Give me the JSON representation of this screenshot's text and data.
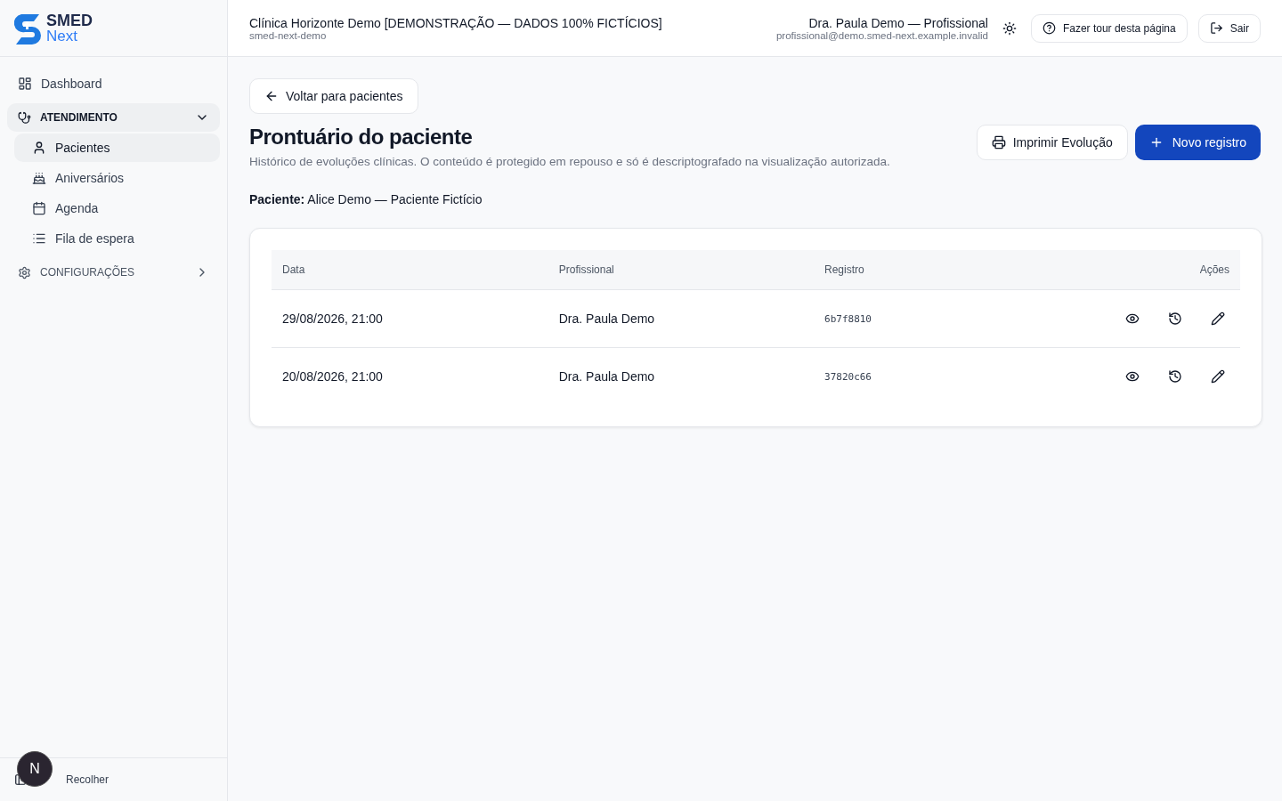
{
  "brand": {
    "name": "SMED",
    "sub": "Next"
  },
  "sidebar": {
    "items": [
      {
        "kind": "link",
        "label": "Dashboard",
        "selected": false
      },
      {
        "kind": "section",
        "label": "ATENDIMENTO",
        "expanded": true,
        "children": [
          {
            "label": "Pacientes",
            "selected": true
          },
          {
            "label": "Aniversários",
            "selected": false
          },
          {
            "label": "Agenda",
            "selected": false
          },
          {
            "label": "Fila de espera",
            "selected": false
          }
        ]
      },
      {
        "kind": "section",
        "label": "CONFIGURAÇÕES",
        "expanded": false
      }
    ],
    "collapse": "Recolher",
    "avatar": "N"
  },
  "header": {
    "clinic": "Clínica Horizonte Demo [DEMONSTRAÇÃO — DADOS 100% FICTÍCIOS]",
    "slug": "smed-next-demo",
    "user": "Dra. Paula Demo — Profissional",
    "email": "profissional@demo.smed-next.example.invalid",
    "tour": "Fazer tour desta página",
    "logout": "Sair"
  },
  "back": "Voltar para pacientes",
  "title": "Prontuário do paciente",
  "description": "Histórico de evoluções clínicas. O conteúdo é protegido em repouso e só é descriptografado na visualização autorizada.",
  "print": "Imprimir Evolução",
  "new": "Novo registro",
  "patient": "**Paciente:** Alice Demo — Paciente Fictício",
  "table": {
    "columns": [
      "Data",
      "Profissional",
      "Registro",
      "Ações"
    ],
    "rows": [
      {
        "date": "29/08/2026, 21:00",
        "professional": "Dra. Paula Demo",
        "record": "6b7f8810"
      },
      {
        "date": "20/08/2026, 21:00",
        "professional": "Dra. Paula Demo",
        "record": "37820c66"
      }
    ]
  }
}
